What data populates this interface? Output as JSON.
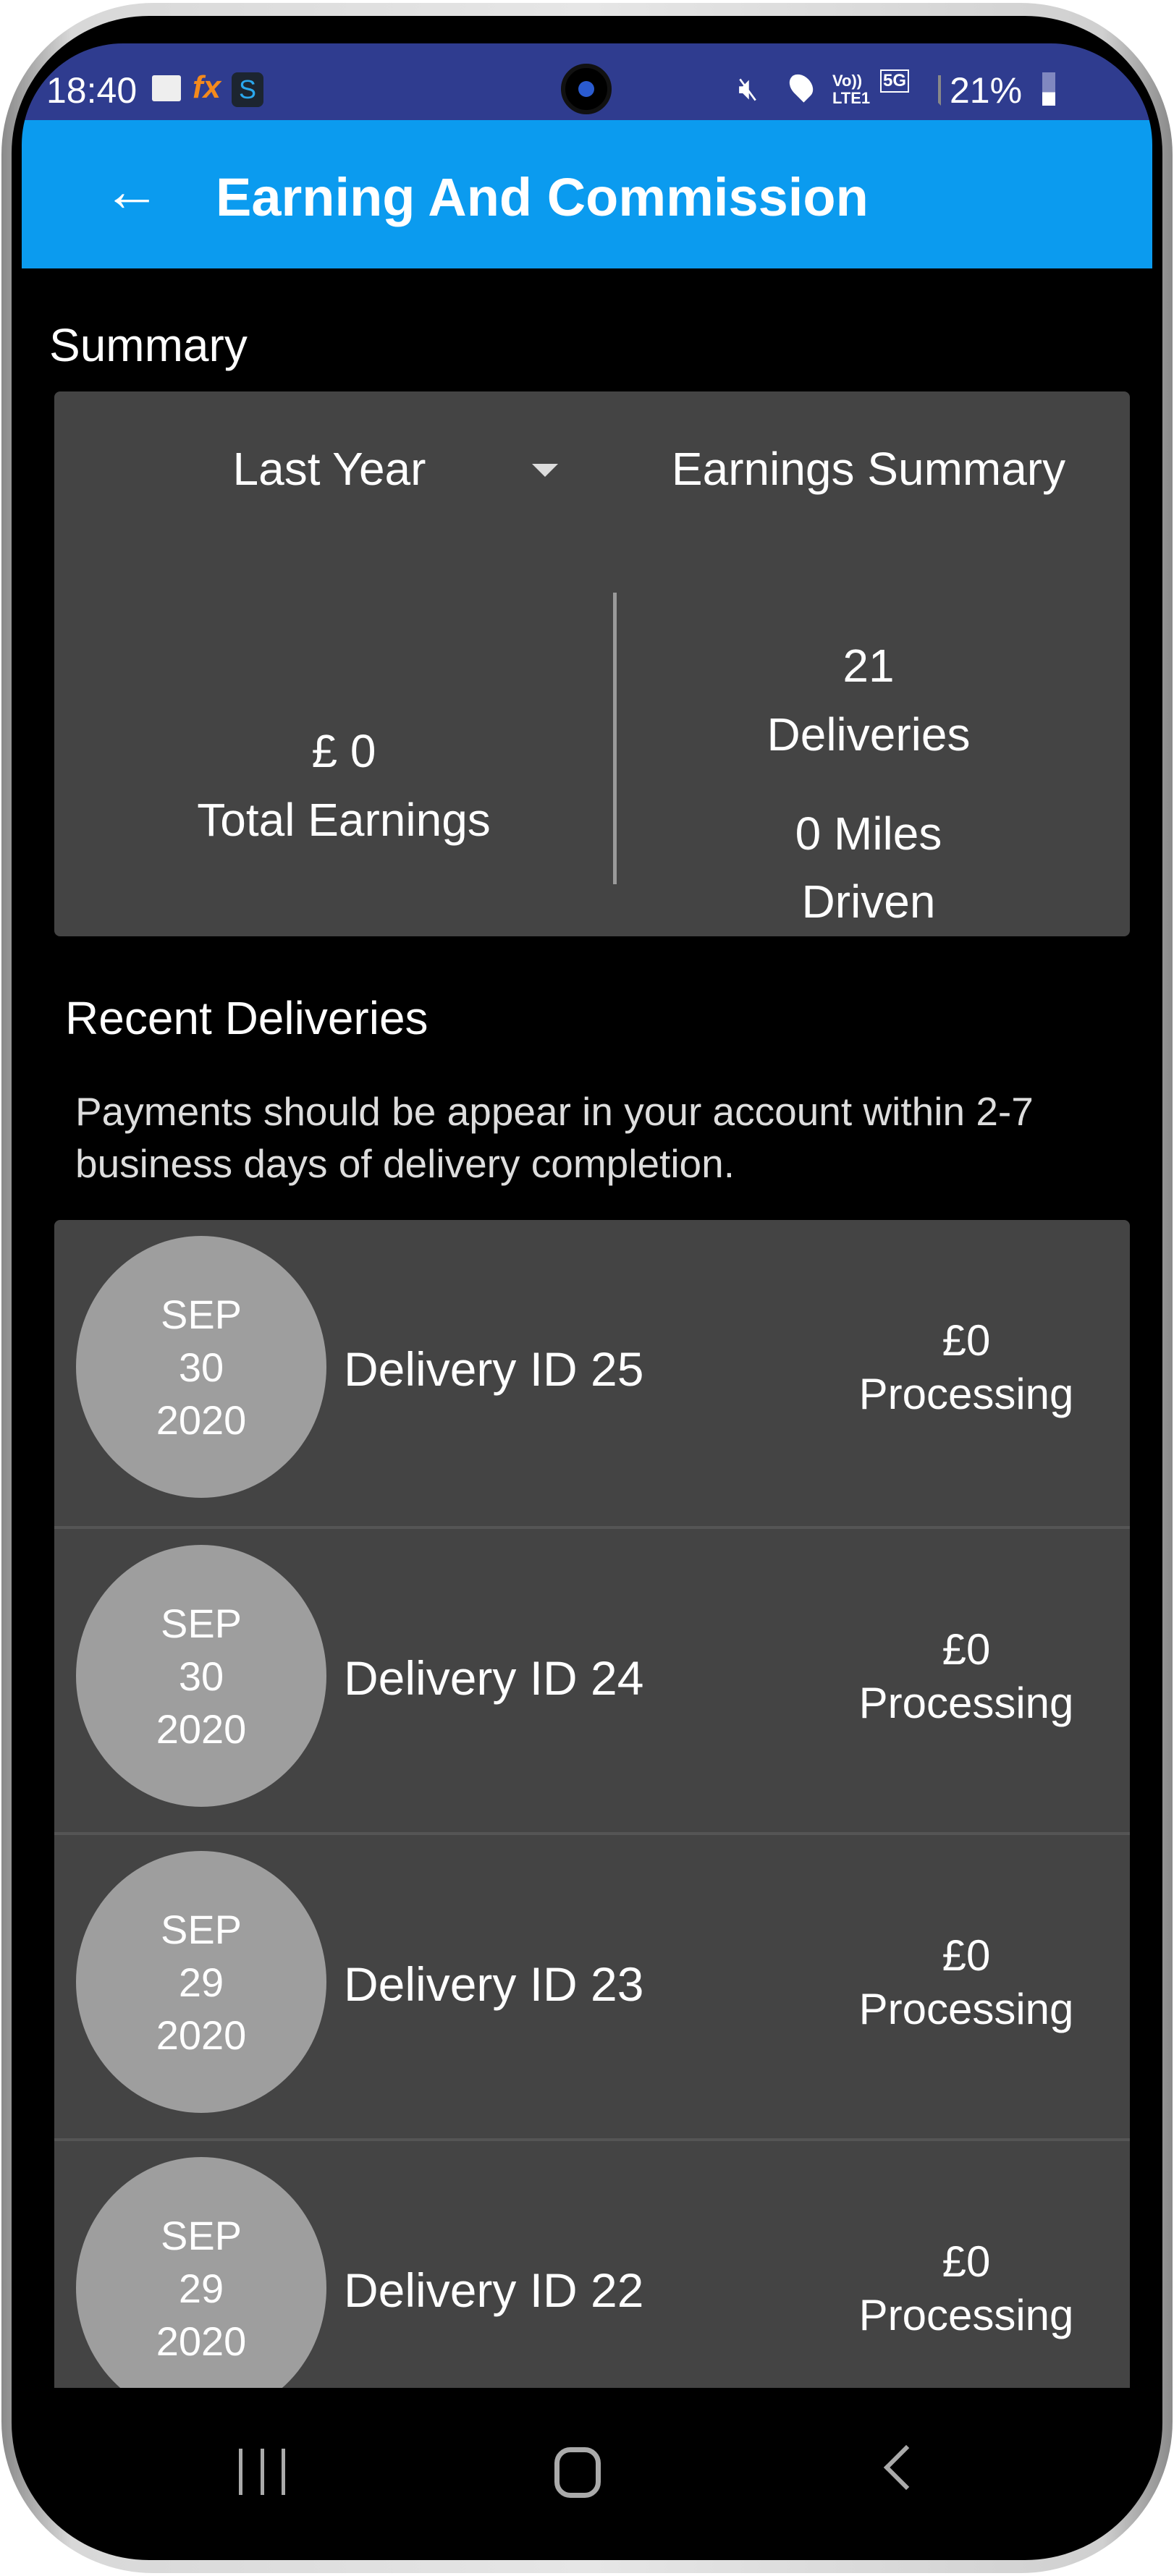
{
  "status_bar": {
    "time": "18:40",
    "battery": "21%",
    "network": "5G",
    "icons": [
      "image-icon",
      "fx-icon",
      "app-icon",
      "mute-icon",
      "location-icon",
      "volte-icon",
      "signal-icon",
      "battery-icon"
    ]
  },
  "app_bar": {
    "title": "Earning And Commission",
    "back_icon": "arrow-left-icon"
  },
  "summary": {
    "heading": "Summary",
    "period": "Last Year",
    "type": "Earnings Summary",
    "total_earnings_value": "£ 0",
    "total_earnings_label": "Total Earnings",
    "deliveries_value": "21",
    "deliveries_label": "Deliveries",
    "miles_value": "0 Miles",
    "miles_label": "Driven"
  },
  "recent": {
    "heading": "Recent Deliveries",
    "note": "Payments should be appear in your account within 2-7 business days of delivery completion.",
    "items": [
      {
        "month": "SEP",
        "day": "30",
        "year": "2020",
        "title": "Delivery ID 25",
        "amount": "£0",
        "status": "Processing"
      },
      {
        "month": "SEP",
        "day": "30",
        "year": "2020",
        "title": "Delivery ID 24",
        "amount": "£0",
        "status": "Processing"
      },
      {
        "month": "SEP",
        "day": "29",
        "year": "2020",
        "title": "Delivery ID 23",
        "amount": "£0",
        "status": "Processing"
      },
      {
        "month": "SEP",
        "day": "29",
        "year": "2020",
        "title": "Delivery ID 22",
        "amount": "£0",
        "status": "Processing"
      }
    ]
  },
  "colors": {
    "status_bar": "#2f3c8f",
    "app_bar": "#0b9bef",
    "card": "#444444",
    "date_circle": "#9e9e9e"
  }
}
